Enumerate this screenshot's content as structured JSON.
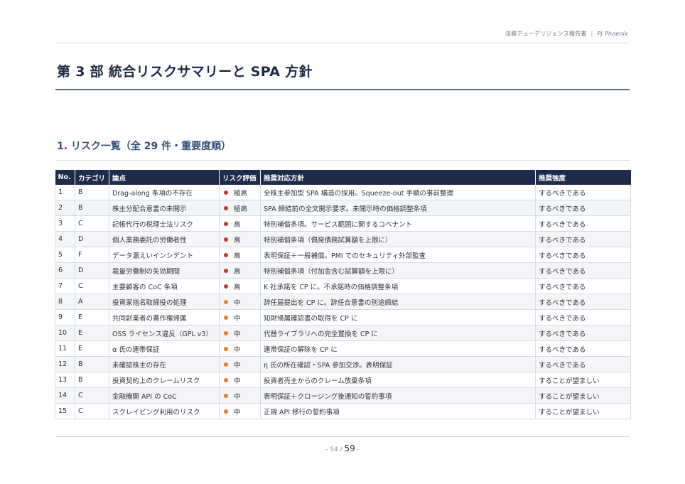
{
  "header": {
    "report_title": "法務デューデリジェンス報告書",
    "separator": "|",
    "project": "PJ Phoenix"
  },
  "page_title": "第 3 部  統合リスクサマリーと SPA 方針",
  "section_title": "1. リスク一覧（全 29 件・重要度順）",
  "table": {
    "columns": [
      "No.",
      "カテゴリ",
      "論点",
      "リスク評価",
      "推奨対応方針",
      "推奨強度"
    ],
    "rows": [
      {
        "no": "1",
        "cat": "B",
        "issue": "Drag-along 条項の不存在",
        "level": "極高",
        "color": "#c0392b",
        "action": "全株主参加型 SPA 構造の採用。Squeeze-out 手順の事前整理",
        "strength": "するべきである"
      },
      {
        "no": "2",
        "cat": "B",
        "issue": "株主分配合意書の未開示",
        "level": "極高",
        "color": "#c0392b",
        "action": "SPA 締結前の全文開示要求。未開示時の価格調整条項",
        "strength": "するべきである"
      },
      {
        "no": "3",
        "cat": "C",
        "issue": "記帳代行の税理士法リスク",
        "level": "高",
        "color": "#c0392b",
        "action": "特別補償条項。サービス範囲に関するコベナント",
        "strength": "するべきである"
      },
      {
        "no": "4",
        "cat": "D",
        "issue": "個人業務委託の労働者性",
        "level": "高",
        "color": "#c0392b",
        "action": "特別補償条項（偶発債務試算額を上限に）",
        "strength": "するべきである"
      },
      {
        "no": "5",
        "cat": "F",
        "issue": "データ漏えいインシデント",
        "level": "高",
        "color": "#c0392b",
        "action": "表明保証＋一般補償。PMI でのセキュリティ外部監査",
        "strength": "するべきである"
      },
      {
        "no": "6",
        "cat": "D",
        "issue": "裁量労働制の失効期間",
        "level": "高",
        "color": "#c0392b",
        "action": "特別補償条項（付加金含む試算額を上限に）",
        "strength": "するべきである"
      },
      {
        "no": "7",
        "cat": "C",
        "issue": "主要顧客の CoC 条項",
        "level": "高",
        "color": "#c0392b",
        "action": "K 社承諾を CP に。不承諾時の価格調整条項",
        "strength": "するべきである"
      },
      {
        "no": "8",
        "cat": "A",
        "issue": "投資家指名取締役の処理",
        "level": "中",
        "color": "#e67e22",
        "action": "辞任届提出を CP に。辞任合意書の別途締結",
        "strength": "するべきである"
      },
      {
        "no": "9",
        "cat": "E",
        "issue": "共同創業者の著作権帰属",
        "level": "中",
        "color": "#e67e22",
        "action": "知財帰属確認書の取得を CP に",
        "strength": "するべきである"
      },
      {
        "no": "10",
        "cat": "E",
        "issue": "OSS ライセンス違反（GPL v3）",
        "level": "中",
        "color": "#e67e22",
        "action": "代替ライブラリへの完全置換を CP に",
        "strength": "するべきである"
      },
      {
        "no": "11",
        "cat": "E",
        "issue": "α 氏の連帯保証",
        "level": "中",
        "color": "#e67e22",
        "action": "連帯保証の解除を CP に",
        "strength": "するべきである"
      },
      {
        "no": "12",
        "cat": "B",
        "issue": "未確認株主の存在",
        "level": "中",
        "color": "#e67e22",
        "action": "η 氏の所在確認・SPA 参加交渉。表明保証",
        "strength": "するべきである"
      },
      {
        "no": "13",
        "cat": "B",
        "issue": "投資契約上のクレームリスク",
        "level": "中",
        "color": "#e67e22",
        "action": "投資者売主からのクレーム放棄条項",
        "strength": "することが望ましい"
      },
      {
        "no": "14",
        "cat": "C",
        "issue": "金融機関 API の CoC",
        "level": "中",
        "color": "#e67e22",
        "action": "表明保証＋クロージング後通知の誓約事項",
        "strength": "することが望ましい"
      },
      {
        "no": "15",
        "cat": "C",
        "issue": "スクレイピング利用のリスク",
        "level": "中",
        "color": "#e67e22",
        "action": "正規 API 移行の誓約事項",
        "strength": "することが望ましい"
      }
    ]
  },
  "pagination": {
    "current": "54",
    "total": "59"
  }
}
